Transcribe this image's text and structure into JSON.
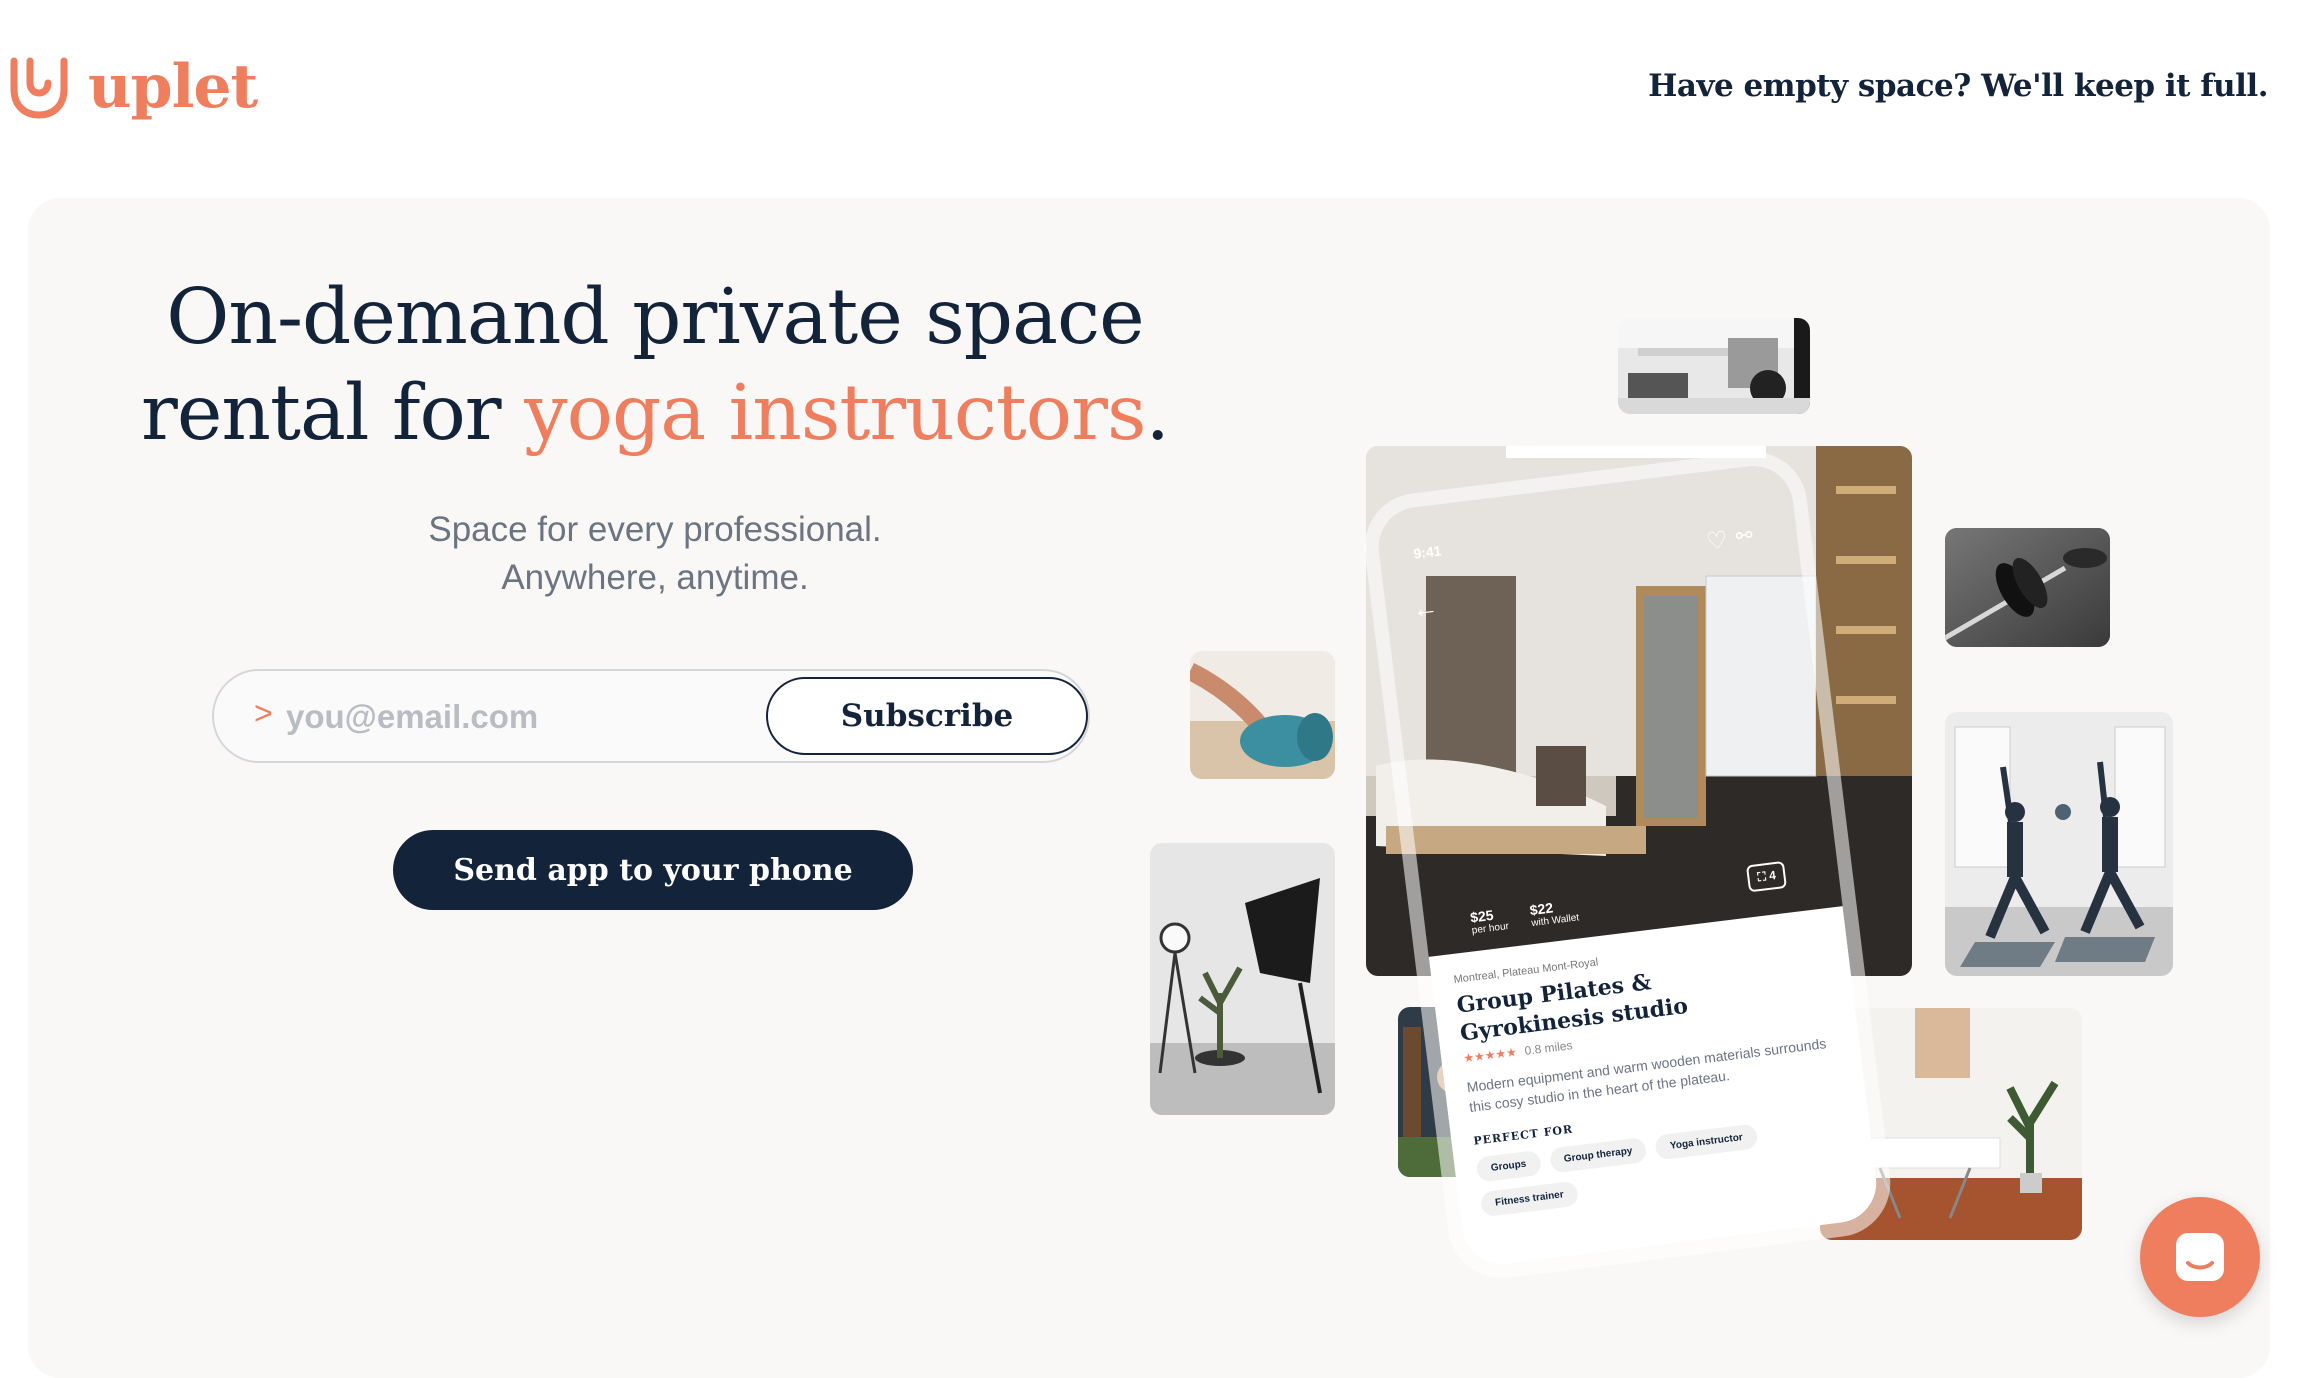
{
  "brand": {
    "name": "uplet",
    "color": "#ee7e5d",
    "dark": "#13233a"
  },
  "header": {
    "tagline_link": "Have empty space? We'll keep it full."
  },
  "hero": {
    "headline_line1": "On-demand private space",
    "headline_prefix": "rental for",
    "headline_accent": "yoga instructors",
    "headline_suffix": ".",
    "sub_line1": "Space for every professional.",
    "sub_line2": "Anywhere, anytime.",
    "email_prompt": ">",
    "email_placeholder": "you@email.com",
    "subscribe_label": "Subscribe",
    "send_app_label": "Send app to your phone"
  },
  "phone": {
    "time": "9:41",
    "price_hour": "$25",
    "price_hour_unit": "per hour",
    "price_wallet": "$22",
    "price_wallet_unit": "with Wallet",
    "photo_count": "4",
    "location": "Montreal, Plateau Mont-Royal",
    "title_line1": "Group Pilates &",
    "title_line2": "Gyrokinesis studio",
    "distance": "0.8 miles",
    "description": "Modern equipment and warm wooden materials surrounds this cosy studio in the heart of the plateau.",
    "perfect_for_label": "PERFECT FOR",
    "chips": [
      "Groups",
      "Group therapy",
      "Yoga instructor",
      "Fitness trainer"
    ]
  },
  "icons": [
    "uplet-logo-icon",
    "chat-icon",
    "back-arrow-icon",
    "heart-icon",
    "share-icon",
    "expand-icon",
    "star-icon"
  ]
}
